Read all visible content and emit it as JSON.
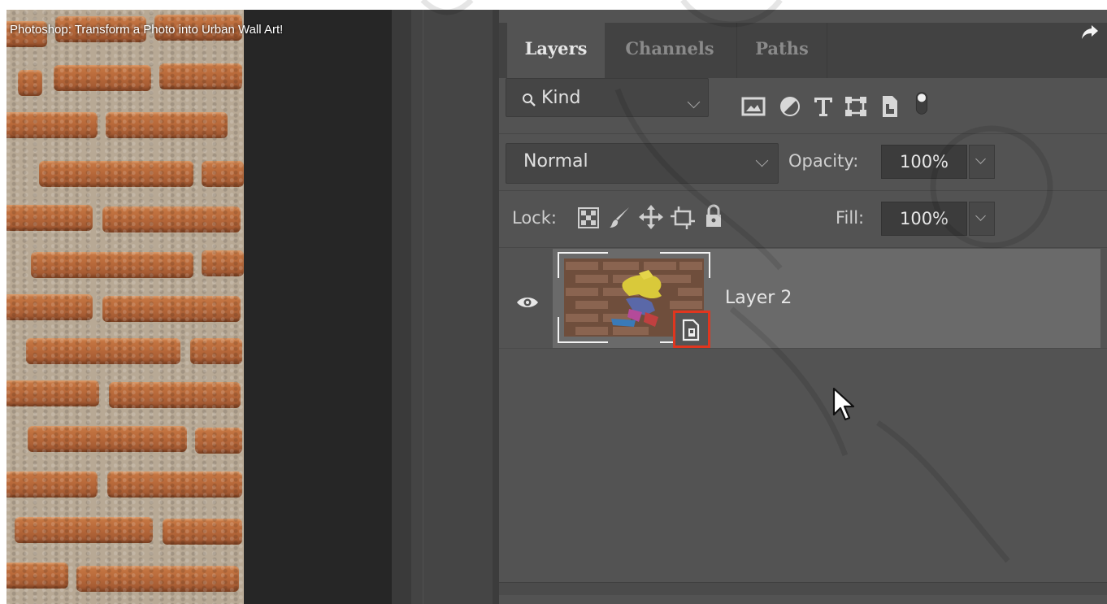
{
  "video": {
    "title": "Photoshop: Transform a Photo into Urban Wall Art!"
  },
  "panel": {
    "tabs": [
      {
        "label": "Layers",
        "active": true
      },
      {
        "label": "Channels",
        "active": false
      },
      {
        "label": "Paths",
        "active": false
      }
    ],
    "filter": {
      "label": "Kind",
      "icons": [
        "image-filter-icon",
        "adjustment-filter-icon",
        "type-filter-icon",
        "shape-filter-icon",
        "smart-object-filter-icon",
        "filter-toggle-icon"
      ]
    },
    "blend_mode": "Normal",
    "opacity_label": "Opacity:",
    "opacity_value": "100%",
    "lock_label": "Lock:",
    "lock_icons": [
      "lock-transparent-icon",
      "lock-image-icon",
      "lock-position-icon",
      "lock-artboard-icon",
      "lock-all-icon"
    ],
    "fill_label": "Fill:",
    "fill_value": "100%",
    "layers": [
      {
        "name": "Layer 2",
        "visible": true,
        "type": "smart-object",
        "selected": true
      }
    ]
  },
  "colors": {
    "panel_bg": "#535353",
    "highlight": "#e0361f",
    "selected_row": "#6a6a6a"
  }
}
